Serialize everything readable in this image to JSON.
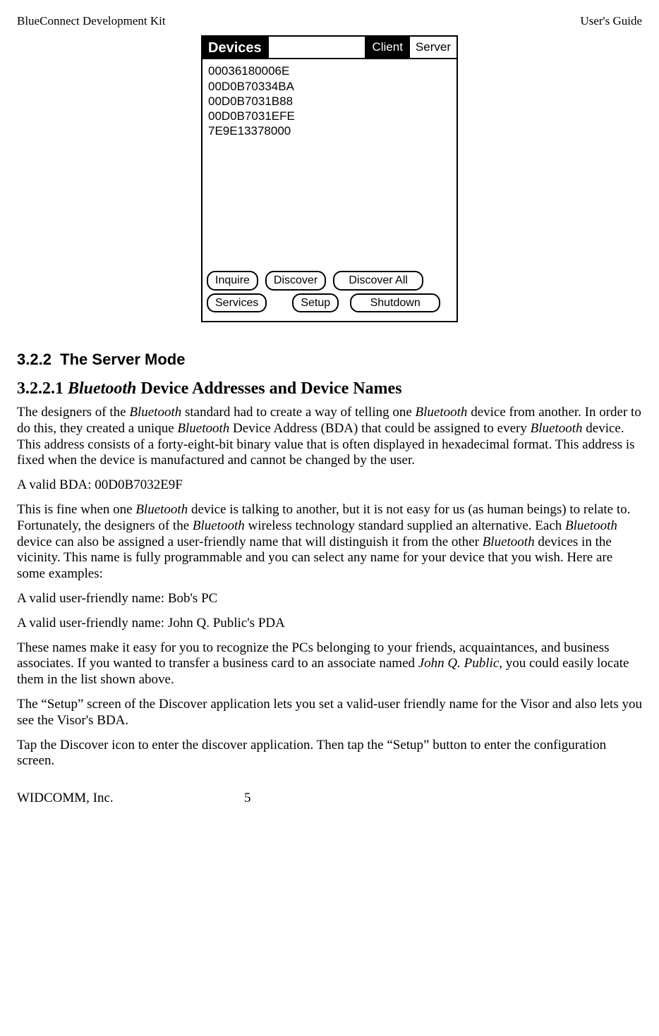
{
  "header": {
    "left": "BlueConnect Development Kit",
    "right": "User's Guide"
  },
  "screenshot": {
    "title": "Devices",
    "tabs": {
      "client": "Client",
      "server": "Server"
    },
    "list": [
      "00036180006E",
      "00D0B70334BA",
      "00D0B7031B88",
      "00D0B7031EFE",
      "7E9E13378000"
    ],
    "buttons": {
      "inquire": "Inquire",
      "discover": "Discover",
      "discover_all": "Discover All",
      "services": "Services",
      "setup": "Setup",
      "shutdown": "Shutdown"
    }
  },
  "section": {
    "num": "3.2.2",
    "title": "The Server Mode"
  },
  "subsection": {
    "num": "3.2.2.1",
    "ital": "Bluetooth",
    "rest": " Device Addresses and Device Names"
  },
  "p1": {
    "a": "The designers of the ",
    "b": "Bluetooth",
    "c": " standard had to create a way of telling one ",
    "d": "Bluetooth",
    "e": " device from another. In order to do this, they created a unique ",
    "f": "Bluetooth",
    "g": " Device Address (BDA) that could be assigned to every ",
    "h": "Bluetooth",
    "i": " device. This address consists of a forty-eight-bit binary value that is often displayed in hexadecimal format. This address is fixed when the device is manufactured and cannot be changed by the user."
  },
  "p2": "A valid BDA:  00D0B7032E9F",
  "p3": {
    "a": "This is fine when one ",
    "b": "Bluetooth",
    "c": " device is talking to another, but it is not easy for us (as human beings) to relate to. Fortunately, the designers of the ",
    "d": "Bluetooth",
    "e": " wireless technology standard supplied an alternative. Each ",
    "f": "Bluetooth",
    "g": " device can also be assigned a user-friendly name that will distinguish it from the other ",
    "h": "Bluetooth",
    "i": " devices in the vicinity. This name is fully programmable and you can select any name for your device that you wish. Here are some examples:"
  },
  "p4": "A valid user-friendly name:    Bob's PC",
  "p5": "A valid user-friendly name:    John Q. Public's PDA",
  "p6": {
    "a": "These names make it easy for you to recognize the PCs belonging to your friends, acquaintances, and business associates. If you wanted to transfer a business card to an associate named ",
    "b": "John Q. Public",
    "c": ", you could easily locate them in the list shown above."
  },
  "p7": "The “Setup” screen of the Discover application lets you set a valid-user friendly name for the Visor  and also lets you see the Visor's BDA.",
  "p8": "Tap the Discover icon to enter the discover application.  Then tap the “Setup” button to enter the configuration screen.",
  "footer": {
    "company": "WIDCOMM, Inc.",
    "page": "5"
  }
}
